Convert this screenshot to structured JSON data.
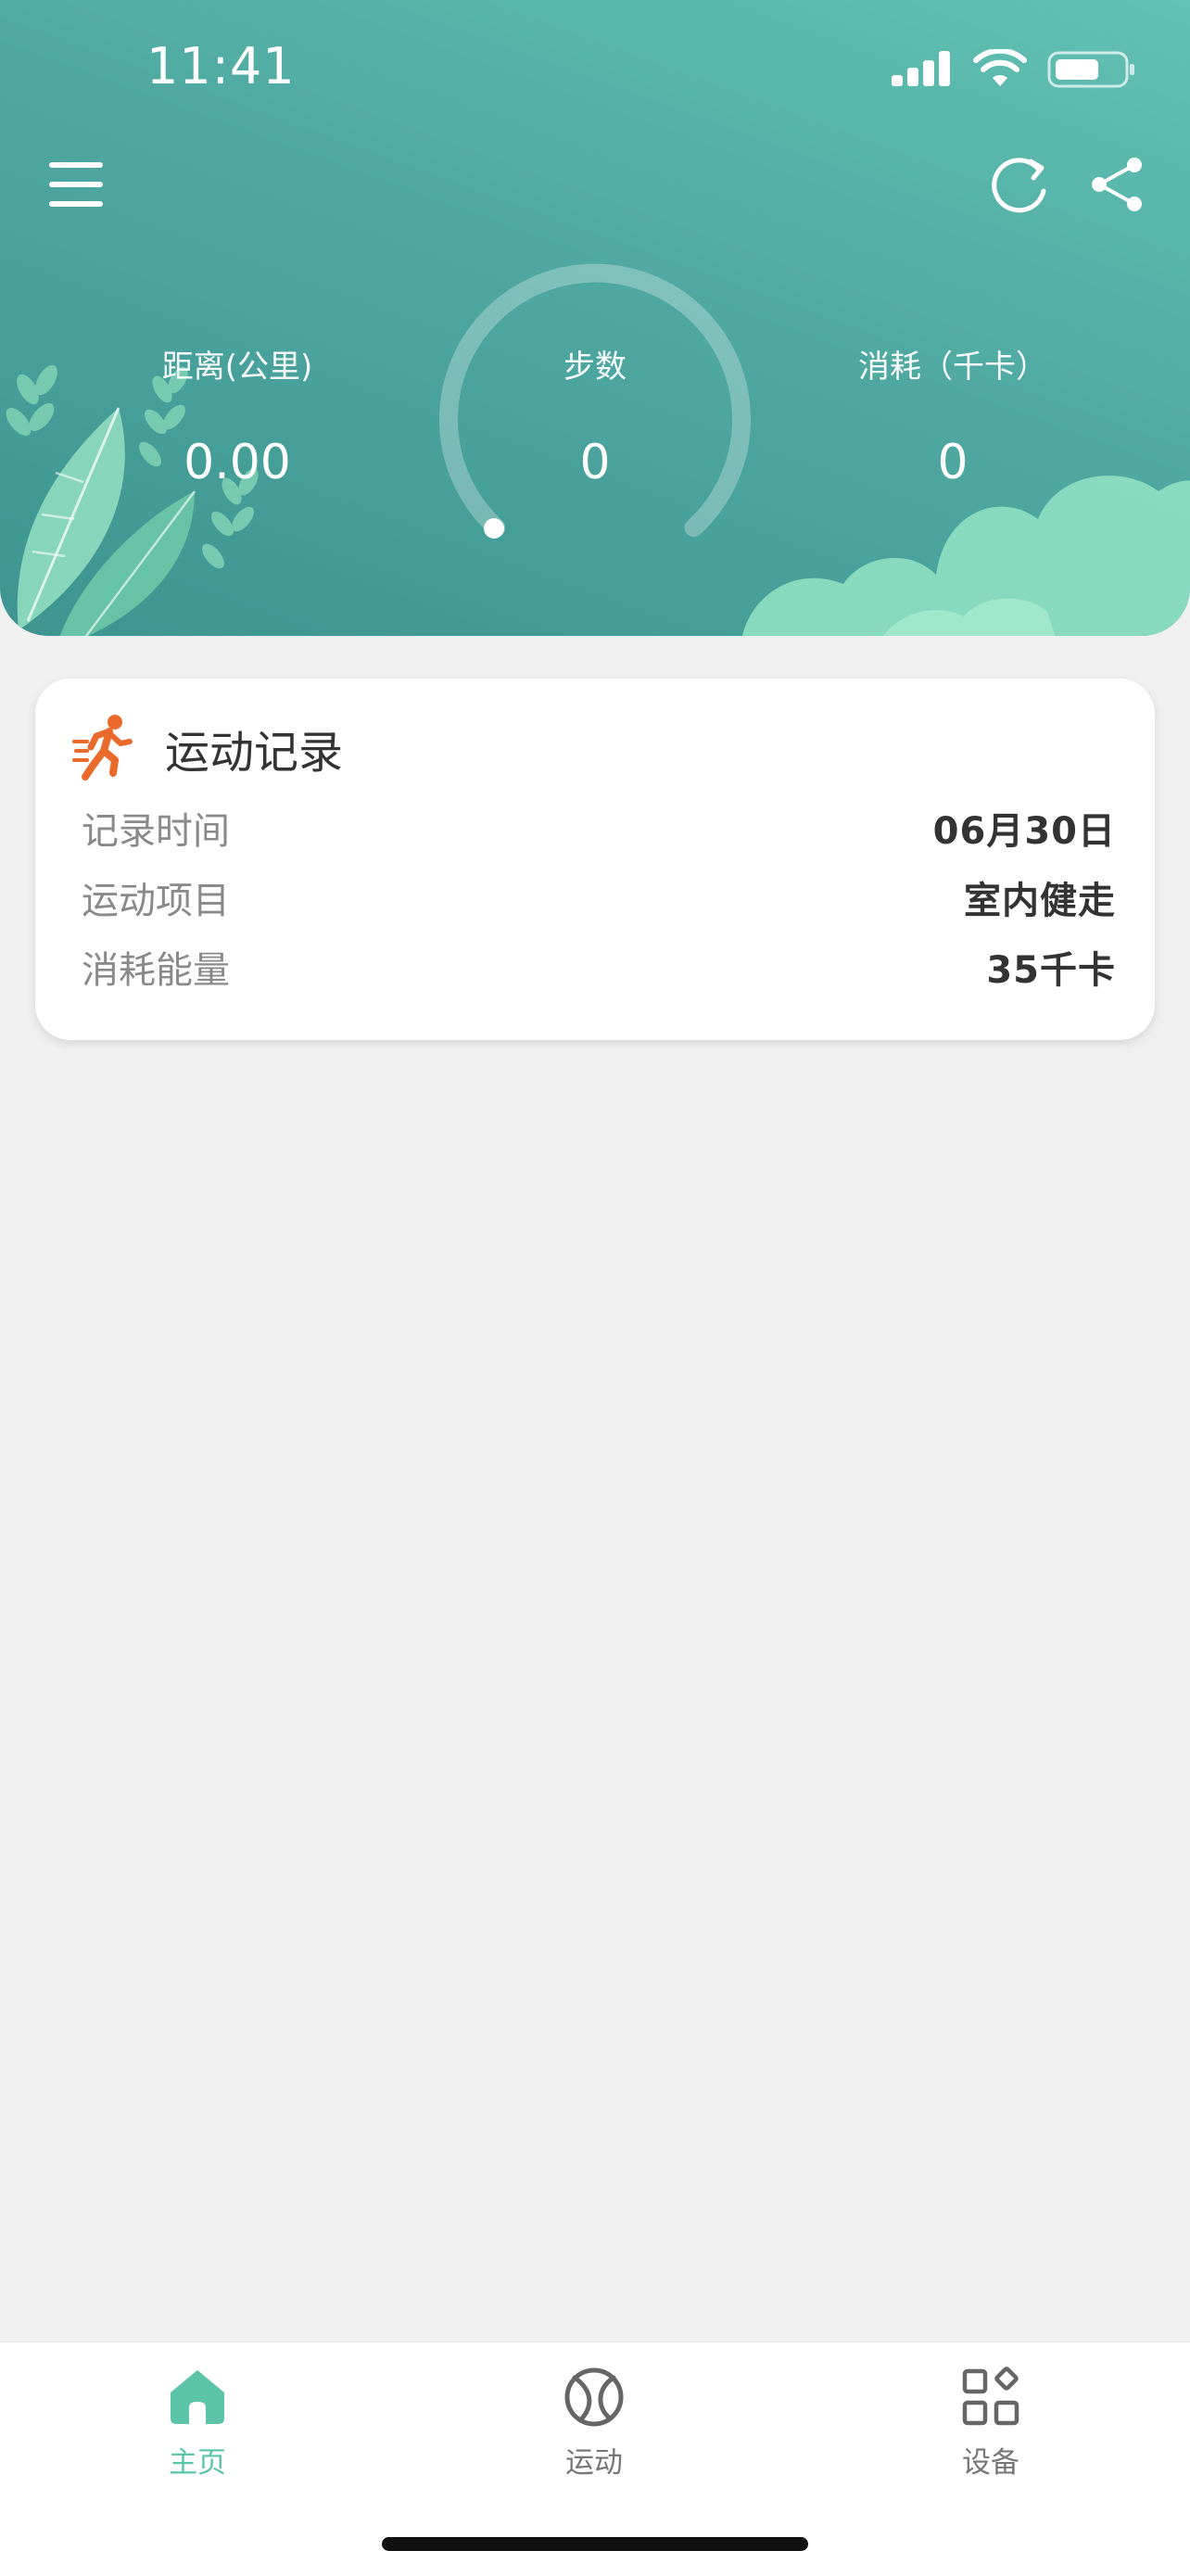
{
  "status_bar": {
    "time": "11:41",
    "icons": [
      "cellular-signal-icon",
      "wifi-icon",
      "battery-icon"
    ]
  },
  "toolbar": {
    "menu_icon": "menu-icon",
    "refresh_icon": "refresh-icon",
    "share_icon": "share-icon"
  },
  "stats": {
    "distance": {
      "label": "距离(公里)",
      "value": "0.00"
    },
    "steps": {
      "label": "步数",
      "value": "0"
    },
    "calories": {
      "label": "消耗（千卡）",
      "value": "0"
    }
  },
  "record_card": {
    "title": "运动记录",
    "icon": "running-person-icon",
    "rows": [
      {
        "key": "记录时间",
        "value": "06月30日"
      },
      {
        "key": "运动项目",
        "value": "室内健走"
      },
      {
        "key": "消耗能量",
        "value": "35千卡"
      }
    ]
  },
  "tabbar": {
    "tabs": [
      {
        "label": "主页",
        "icon": "home-icon",
        "active": true
      },
      {
        "label": "运动",
        "icon": "sports-ball-icon",
        "active": false
      },
      {
        "label": "设备",
        "icon": "devices-grid-icon",
        "active": false
      }
    ]
  },
  "colors": {
    "header_teal": "#4fa9a1",
    "accent_green": "#5bc4a9",
    "record_icon_orange": "#ea6a2c",
    "tab_inactive": "#777777"
  }
}
